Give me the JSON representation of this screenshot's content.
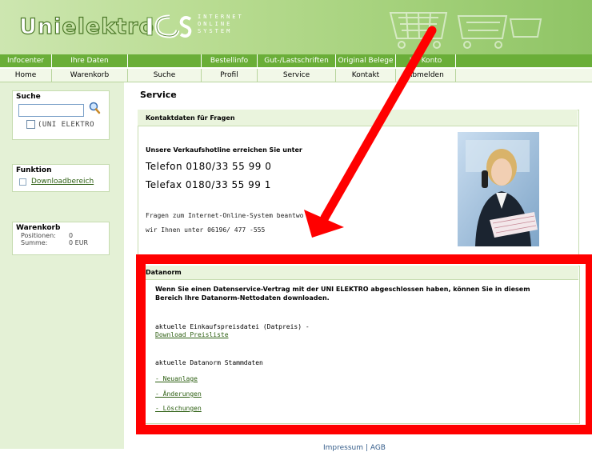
{
  "header": {
    "logo_uni": "Uni",
    "logo_elektro": "elektro",
    "ios_sub": "INTERNET\nONLINE\nSYSTEM"
  },
  "nav1": [
    "Infocenter",
    "Ihre Daten",
    "",
    "Bestellinfo",
    "Gut-/Lastschriften",
    "Original Belege",
    "Ihr Konto"
  ],
  "nav2": [
    "Home",
    "Warenkorb",
    "Suche",
    "Profil",
    "Service",
    "Kontakt",
    "Abmelden"
  ],
  "sidebar": {
    "search": {
      "title": "Suche",
      "check_label": "(UNI ELEKTRO"
    },
    "funktion": {
      "title": "Funktion",
      "link": "Downloadbereich"
    },
    "warenkorb": {
      "title": "Warenkorb",
      "positionen_label": "Positionen:",
      "positionen_value": "0",
      "summe_label": "Summe:",
      "summe_value": "0 EUR"
    }
  },
  "main": {
    "page_title": "Service",
    "kontakt": {
      "title": "Kontaktdaten für Fragen",
      "hotline": "Unsere Verkaufshotline erreichen Sie unter",
      "telefon": "Telefon 0180/33 55 99 0",
      "telefax": "Telefax 0180/33 55 99 1",
      "fragen_line1": "Fragen zum Internet-Online-System beantwo",
      "fragen_line2": "wir Ihnen unter 06196/ 477 -555"
    },
    "datanorm": {
      "title": "Datanorm",
      "intro": "Wenn Sie einen Datenservice-Vertrag mit der UNI ELEKTRO abgeschlossen haben, können Sie in diesem Bereich Ihre Datanorm-Nettodaten downloaden.",
      "preis_text": "aktuelle Einkaufspreisdatei (Datpreis) -",
      "preis_link": "Download Preisliste",
      "stamm_text": "aktuelle Datanorm Stammdaten",
      "links": [
        "- Neuanlage",
        "- Änderungen",
        "- Löschungen"
      ]
    }
  },
  "footer": {
    "impressum": "Impressum",
    "sep": "|",
    "agb": "AGB"
  },
  "colors": {
    "nav_green": "#6aae38",
    "annotation_red": "#ff0000",
    "sidebar_bg": "#e4f1d6"
  }
}
